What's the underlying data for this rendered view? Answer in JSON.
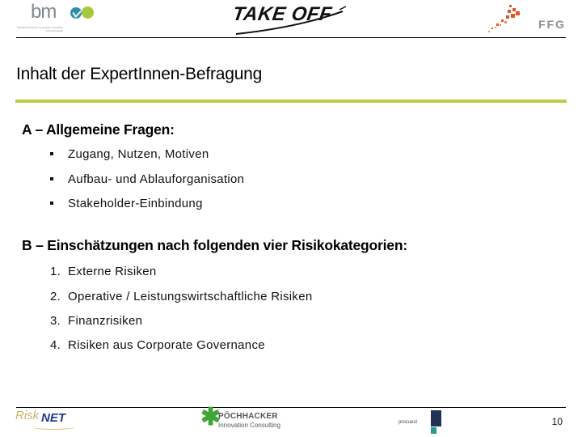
{
  "header": {
    "logos": {
      "left": {
        "name": "bmvit",
        "text": "bm",
        "tagline": "Bundesministerium für Verkehr, Innovation und Technologie"
      },
      "center": {
        "name": "TAKE OFF",
        "text": "TAKE OFF"
      },
      "right": {
        "name": "FFG",
        "text": "FFG"
      }
    }
  },
  "slide": {
    "title": "Inhalt der ExpertInnen-Befragung",
    "sections": [
      {
        "heading": "A – Allgemeine Fragen:",
        "list_style": "bullet",
        "items": [
          "Zugang, Nutzen, Motiven",
          "Aufbau- und Ablauforganisation",
          "Stakeholder-Einbindung"
        ]
      },
      {
        "heading": "B – Einschätzungen nach folgenden vier Risikokategorien:",
        "list_style": "numbered",
        "items": [
          {
            "num": "1.",
            "text": "Externe Risiken"
          },
          {
            "num": "2.",
            "text": "Operative / Leistungswirtschaftliche Risiken"
          },
          {
            "num": "3.",
            "text": "Finanzrisiken"
          },
          {
            "num": "4.",
            "text": "Risiken aus Corporate Governance"
          }
        ]
      }
    ]
  },
  "footer": {
    "logos": {
      "risknet": {
        "risk": "Risk",
        "net": "NET"
      },
      "poechhacker": {
        "name": "PÖCHHACKER",
        "sub": "Innovation Consulting"
      },
      "pc": {
        "text": "procuest"
      }
    },
    "page_number": "10"
  },
  "colors": {
    "accent_line": "#b6d144",
    "text": "#000000"
  }
}
